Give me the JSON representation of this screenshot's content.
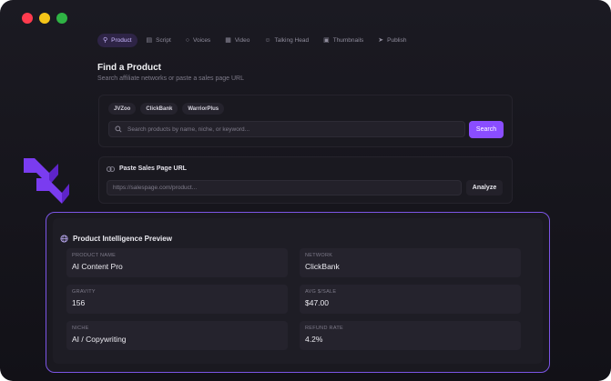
{
  "tabs": [
    {
      "label": "Product",
      "icon": "search-icon",
      "active": true
    },
    {
      "label": "Script",
      "icon": "document-icon",
      "active": false
    },
    {
      "label": "Voices",
      "icon": "microphone-icon",
      "active": false
    },
    {
      "label": "Video",
      "icon": "film-icon",
      "active": false
    },
    {
      "label": "Talking Head",
      "icon": "face-icon",
      "active": false
    },
    {
      "label": "Thumbnails",
      "icon": "image-icon",
      "active": false
    },
    {
      "label": "Publish",
      "icon": "send-icon",
      "active": false
    }
  ],
  "find": {
    "title": "Find a Product",
    "subtitle": "Search affiliate networks or paste a sales page URL",
    "networks": [
      "JVZoo",
      "ClickBank",
      "WarriorPlus"
    ],
    "search_placeholder": "Search products by name, niche, or keyword...",
    "search_button": "Search"
  },
  "sales_page": {
    "title": "Paste Sales Page URL",
    "url_placeholder": "https://salespage.com/product...",
    "analyze_button": "Analyze"
  },
  "preview": {
    "title": "Product Intelligence Preview",
    "fields": [
      {
        "label": "PRODUCT NAME",
        "value": "AI Content Pro"
      },
      {
        "label": "NETWORK",
        "value": "ClickBank"
      },
      {
        "label": "GRAVITY",
        "value": "156"
      },
      {
        "label": "AVG $/SALE",
        "value": "$47.00"
      },
      {
        "label": "NICHE",
        "value": "AI / Copywriting"
      },
      {
        "label": "REFUND RATE",
        "value": "4.2%"
      }
    ]
  },
  "colors": {
    "accent": "#8a4dff",
    "chevron": "#7a3cf0",
    "panel_border": "#7c55e6"
  }
}
